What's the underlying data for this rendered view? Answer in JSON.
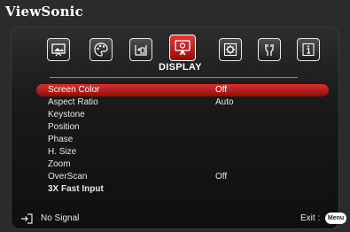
{
  "brand": "ViewSonic",
  "tabs": [
    {
      "name": "picture-icon",
      "active": false
    },
    {
      "name": "color-palette-icon",
      "active": false
    },
    {
      "name": "source-input-icon",
      "active": false
    },
    {
      "name": "display-icon",
      "active": true
    },
    {
      "name": "settings-gear-icon",
      "active": false
    },
    {
      "name": "advanced-tools-icon",
      "active": false
    },
    {
      "name": "information-icon",
      "active": false
    }
  ],
  "active_tab_title": "DISPLAY",
  "menu": {
    "items": [
      {
        "label": "Screen Color",
        "value": "Off",
        "selected": true
      },
      {
        "label": "Aspect Ratio",
        "value": "Auto"
      },
      {
        "label": "Keystone",
        "value": ""
      },
      {
        "label": "Position",
        "value": ""
      },
      {
        "label": "Phase",
        "value": ""
      },
      {
        "label": "H. Size",
        "value": ""
      },
      {
        "label": "Zoom",
        "value": ""
      },
      {
        "label": "OverScan",
        "value": "Off"
      },
      {
        "label": "3X Fast Input",
        "value": "",
        "bold": true
      }
    ]
  },
  "footer": {
    "signal_icon": "input-source-icon",
    "signal_text": "No Signal",
    "exit_text": "Exit :",
    "menu_button": "Menu"
  },
  "colors": {
    "accent": "#c41e1e",
    "background": "#2b2b2b",
    "text": "#ffffff"
  }
}
